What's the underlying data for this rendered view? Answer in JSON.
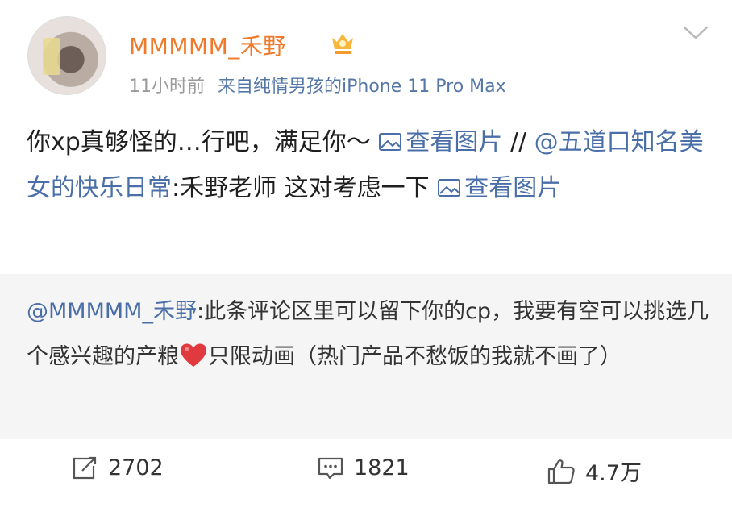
{
  "user": {
    "name": "MMMMM_禾野",
    "time": "11小时前",
    "source_prefix": "来自",
    "source": "纯情男孩的iPhone 11 Pro Max"
  },
  "post": {
    "text_before": "你xp真够怪的…行吧，满足你～",
    "image_link_1": "查看图片",
    "separator": " //",
    "mention": "@五道口知名美女的快乐日常",
    "text_after": ":禾野老师 这对考虑一下",
    "image_link_2": "查看图片"
  },
  "repost": {
    "mention": "@MMMMM_禾野",
    "text_part1": ":此条评论区里可以留下你的cp，我要有空可以挑选几个感兴趣的产粮",
    "text_part2": "只限动画（热门产品不愁饭的我就不画了）"
  },
  "actions": {
    "repost_count": "2702",
    "comment_count": "1821",
    "like_count": "4.7万"
  },
  "colors": {
    "username": "#f07a2a",
    "link": "#4a6fa8",
    "repost_bg": "#f5f5f5"
  },
  "icons": [
    "chevron-down-icon",
    "vip-badge-icon",
    "image-icon",
    "heart-icon",
    "repost-icon",
    "comment-icon",
    "like-icon"
  ]
}
